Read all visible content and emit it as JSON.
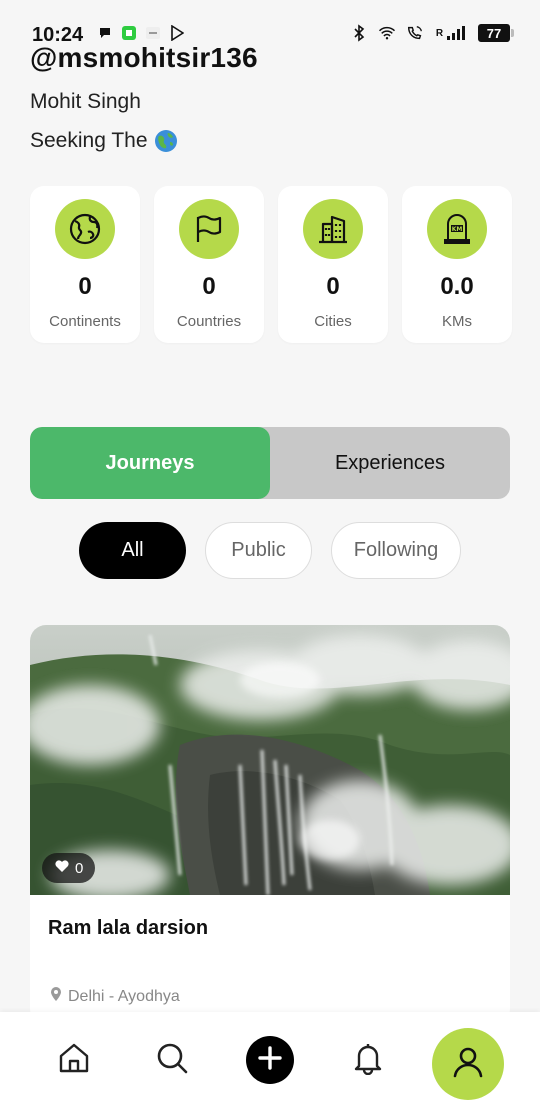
{
  "status_bar": {
    "time": "10:24",
    "battery": "77",
    "network_label": "R",
    "left_icons": [
      "chat-icon",
      "app-icon",
      "app-icon",
      "play-store-icon"
    ],
    "right_icons": [
      "bluetooth-icon",
      "wifi-icon",
      "wifi-call-icon",
      "signal-icon",
      "battery-icon"
    ]
  },
  "profile": {
    "handle": "@msmohitsir136",
    "name": "Mohit Singh",
    "bio": "Seeking The",
    "bio_emoji": "globe-emoji"
  },
  "stats": [
    {
      "value": "0",
      "label": "Continents",
      "icon": "globe-icon"
    },
    {
      "value": "0",
      "label": "Countries",
      "icon": "flag-icon"
    },
    {
      "value": "0",
      "label": "Cities",
      "icon": "building-icon"
    },
    {
      "value": "0.0",
      "label": "KMs",
      "icon": "milestone-icon"
    }
  ],
  "tabs": {
    "journeys": "Journeys",
    "experiences": "Experiences",
    "active": "journeys"
  },
  "filters": {
    "all": "All",
    "public": "Public",
    "following": "Following",
    "active": "all"
  },
  "journey_card": {
    "title": "Ram lala darsion",
    "location": "Delhi - Ayodhya",
    "likes": "0"
  },
  "nav": [
    "home-icon",
    "search-icon",
    "add-icon",
    "bell-icon",
    "profile-icon"
  ],
  "colors": {
    "accent_green": "#b5d94a",
    "tab_active": "#4cb86a",
    "background": "#f6f6f6"
  }
}
